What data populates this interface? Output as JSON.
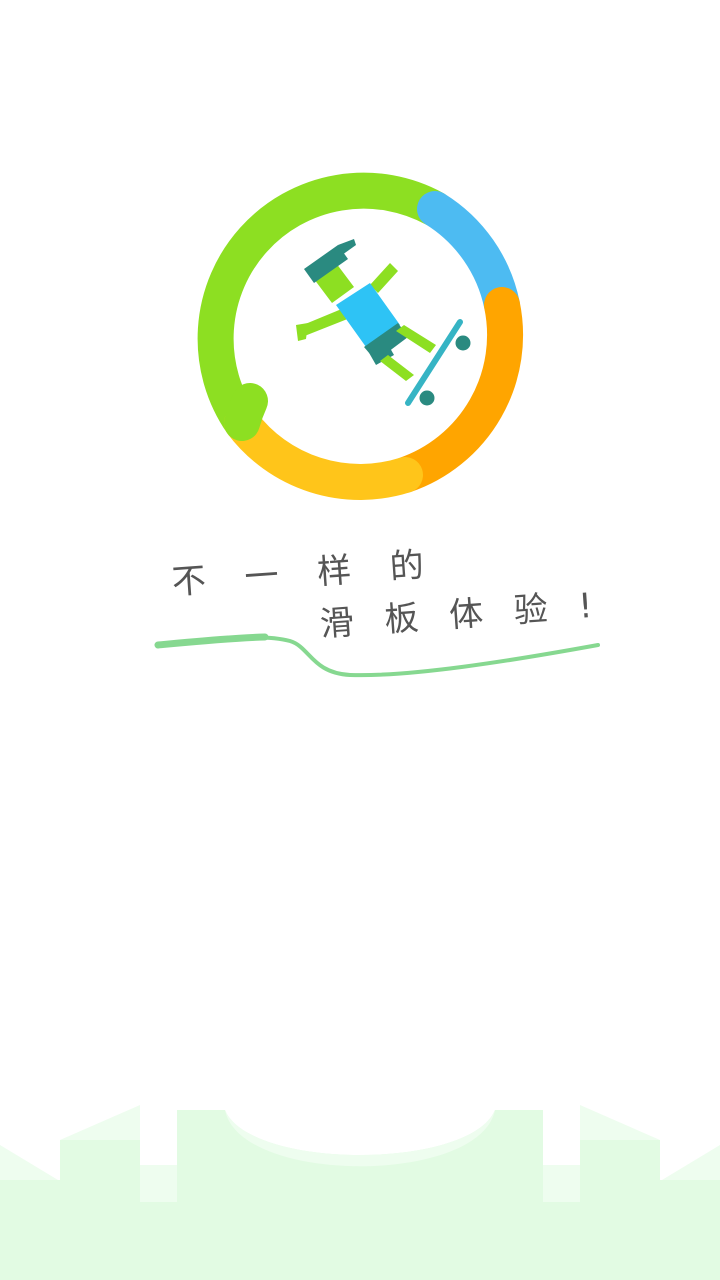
{
  "splash": {
    "slogan_line1": "不 一 样 的",
    "slogan_line2": "滑 板 体 验 !"
  },
  "colors": {
    "ring_green": "#8ddf22",
    "ring_blue": "#4dbbf2",
    "ring_orange": "#ffa500",
    "ring_yellow": "#ffc51a",
    "skater_green": "#8ddf22",
    "skater_shirt": "#2ec3f5",
    "skater_dark": "#2a8a80",
    "board": "#36b4c4",
    "swoosh": "#86d890",
    "ground_light": "#e2fbe3",
    "ground_lighter": "#eefdef",
    "text": "#555555"
  },
  "icons": {
    "logo": "skateboarder-ring-logo",
    "ground": "skatepark-silhouette"
  }
}
